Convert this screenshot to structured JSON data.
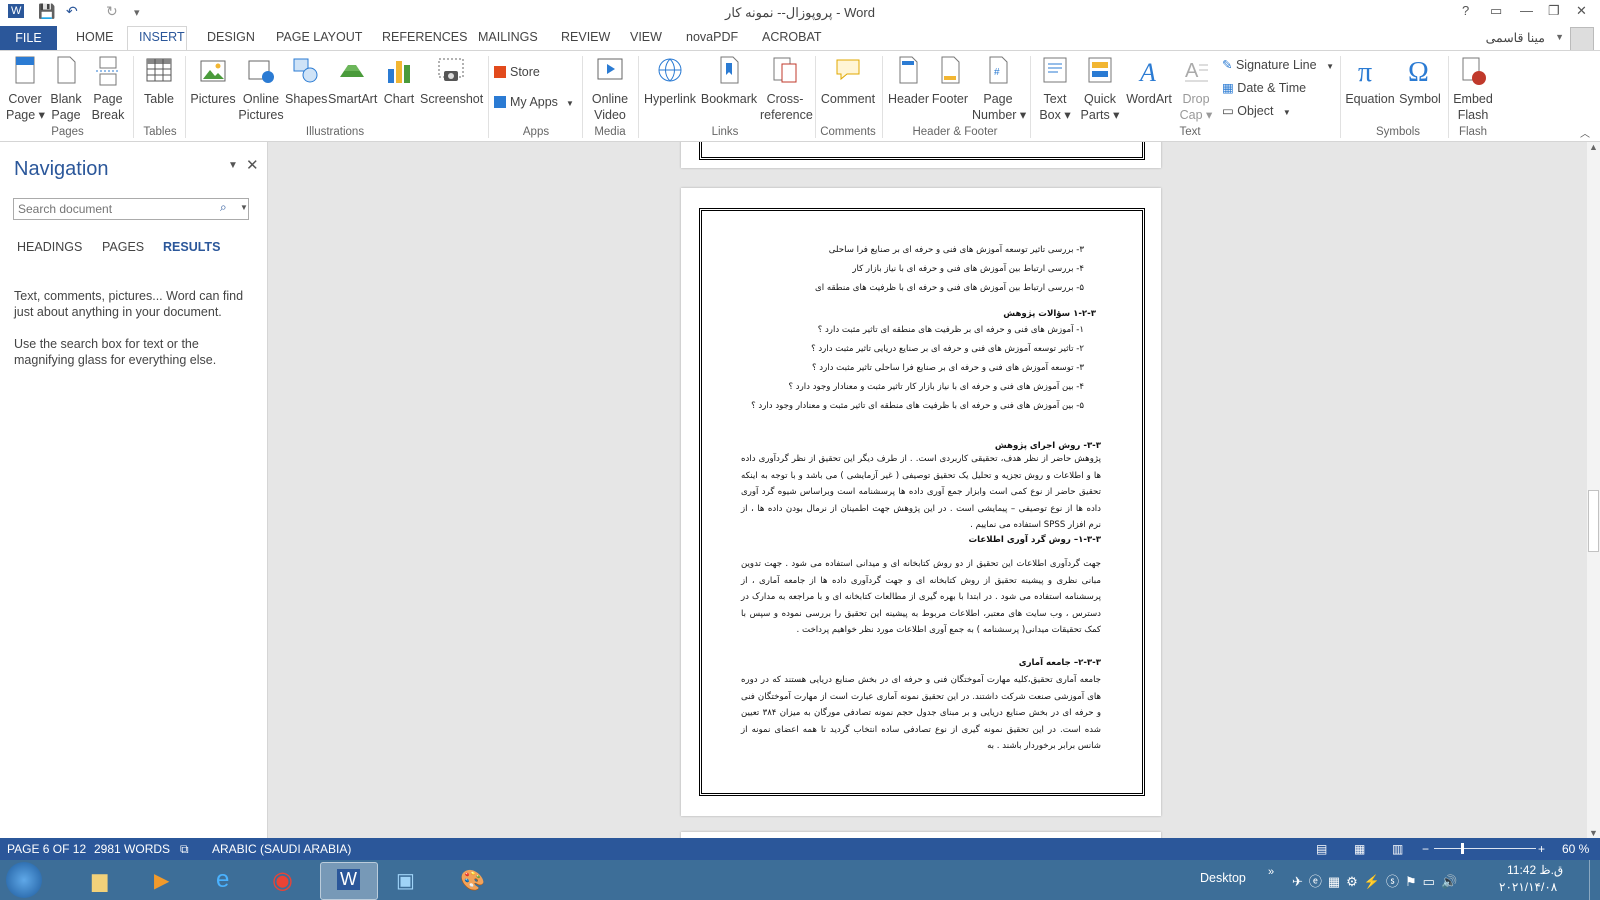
{
  "window": {
    "title": "پروپوزال-- نمونه کار - Word",
    "help": "?",
    "quick_access": [
      "W",
      "💾",
      "↶",
      "↻",
      "▾"
    ]
  },
  "tabs": [
    "FILE",
    "HOME",
    "INSERT",
    "DESIGN",
    "PAGE LAYOUT",
    "REFERENCES",
    "MAILINGS",
    "REVIEW",
    "VIEW",
    "novaPDF",
    "ACROBAT"
  ],
  "account": {
    "name": "مینا قاسمی"
  },
  "ribbon": {
    "pages": {
      "cover": "Cover\nPage ▾",
      "blank": "Blank\nPage",
      "break": "Page\nBreak",
      "group": "Pages"
    },
    "tables": {
      "table": "Table",
      "group": "Tables"
    },
    "illustrations": {
      "pictures": "Pictures",
      "online": "Online\nPictures",
      "shapes": "Shapes",
      "smartart": "SmartArt",
      "chart": "Chart",
      "screenshot": "Screenshot",
      "group": "Illustrations"
    },
    "apps": {
      "store": "Store",
      "myapps": "My Apps",
      "group": "Apps"
    },
    "media": {
      "video": "Online\nVideo",
      "group": "Media"
    },
    "links": {
      "hyperlink": "Hyperlink",
      "bookmark": "Bookmark",
      "xref": "Cross-\nreference",
      "group": "Links"
    },
    "comments": {
      "comment": "Comment",
      "group": "Comments"
    },
    "headerfooter": {
      "header": "Header",
      "footer": "Footer",
      "pagenum": "Page\nNumber ▾",
      "group": "Header & Footer"
    },
    "text": {
      "textbox": "Text\nBox ▾",
      "quickparts": "Quick\nParts ▾",
      "wordart": "WordArt",
      "dropcap": "Drop\nCap ▾",
      "signature": "Signature Line",
      "datetime": "Date & Time",
      "object": "Object",
      "group": "Text"
    },
    "symbols": {
      "equation": "Equation",
      "symbol": "Symbol",
      "group": "Symbols"
    },
    "flash": {
      "embed": "Embed\nFlash",
      "group": "Flash"
    }
  },
  "navigation": {
    "title": "Navigation",
    "search_placeholder": "Search document",
    "tabs": [
      "HEADINGS",
      "PAGES",
      "RESULTS"
    ],
    "help1": "Text, comments, pictures... Word can find just about anything in your document.",
    "help2": "Use the search box for text or the magnifying glass for everything else."
  },
  "document": {
    "objectives": [
      "۳- بررسی تاثیر توسعه آموزش های فنی و حرفه ای بر صنایع فرا ساحلی",
      "۴- بررسی ارتباط بین آموزش های فنی و حرفه ای با نیاز بازار کار",
      "۵- بررسی ارتباط بین آموزش های فنی و حرفه ای با ظرفیت های منطقه ای"
    ],
    "questions_heading": "۱-۲-۳ سؤالات پژوهش",
    "questions": [
      "۱- آموزش های فنی و حرفه ای بر ظرفیت های منطقه ای تاثیر مثبت دارد ؟",
      "۲- تاثیر توسعه آموزش های فنی و حرفه ای بر صنایع دریایی تاثیر مثبت دارد ؟",
      "۳- توسعه آموزش های فنی و حرفه ای بر صنایع فرا ساحلی تاثیر مثبت دارد ؟",
      "۴- بین آموزش های فنی و حرفه ای با نیاز بازار کار تاثیر مثبت و معنادار وجود دارد ؟",
      "۵- بین آموزش های فنی و حرفه ای با ظرفیت های منطقه ای تاثیر مثبت و معنادار وجود دارد ؟"
    ],
    "method_heading": "۳-۳- روش اجرای پژوهش",
    "method_text": "پژوهش حاضر از نظر هدف، تحقیقی کاربردی است. . از طرف دیگر این تحقیق از نظر گردآوری داده ها و اطلاعات و روش تجزیه و تحلیل یک تحقیق توصیفی ( غیر آزمایشی ) می باشد و با توجه به اینکه تحقیق حاضر از نوع کمی است وابزار جمع آوری داده ها پرسشنامه است وبراساس شیوه گرد آوری داده ها از نوع توصیفی – پیمایشی است . در این پژوهش جهت اطمینان از نرمال بودن داده ها ، از نرم افزار SPSS استفاده می نماییم .",
    "collect_heading": "۱-۳-۳– روش گرد آوری اطلاعات",
    "collect_text": "جهت گردآوری اطلاعات این تحقیق از دو روش کتابخانه ای و میدانی استفاده می شود . جهت تدوین مبانی نظری و پیشینه تحقیق از روش کتابخانه ای و جهت گردآوری داده ها از جامعه آماری ، از پرسشنامه استفاده می شود . در ابتدا با بهره گیری از مطالعات کتابخانه ای و با مراجعه به مدارک در دسترس ، وب سایت های معتبر، اطلاعات مربوط به پیشینه این تحقیق را بررسی نموده و سپس با کمک تحقیقات میدانی( پرسشنامه ) به جمع آوری اطلاعات مورد نظر خواهیم پرداخت .",
    "pop_heading": "۲-۳-۳– جامعه آماری",
    "pop_text": "جامعه آماری تحقیق،کلیه مهارت آموختگان فنی و حرفه ای در بخش صنایع دریایی هستند که در دوره های آموزشی صنعت شرکت داشتند. در این تحقیق نمونه آماری عبارت است از مهارت آموختگان فنی و حرفه ای در بخش صنایع دریایی و بر مبنای جدول حجم نمونه تصادفی مورگان به میزان ۳۸۴ تعیین شده است. در این تحقیق نمونه گیری از نوع تصادفی ساده انتخاب گردید تا همه اعضای نمونه از شانس برابر برخوردار باشند . به"
  },
  "status": {
    "page": "PAGE 6 OF 12",
    "words": "2981 WORDS",
    "language": "ARABIC (SAUDI ARABIA)",
    "zoom": "60 %",
    "zoom_level": 60
  },
  "taskbar": {
    "desktop": "Desktop",
    "time": "11:42 ق.ظ",
    "date": "۲۰۲۱/۱۴/۰۸"
  },
  "colors": {
    "accent": "#2b579a",
    "taskbar": "#3d6e98"
  }
}
